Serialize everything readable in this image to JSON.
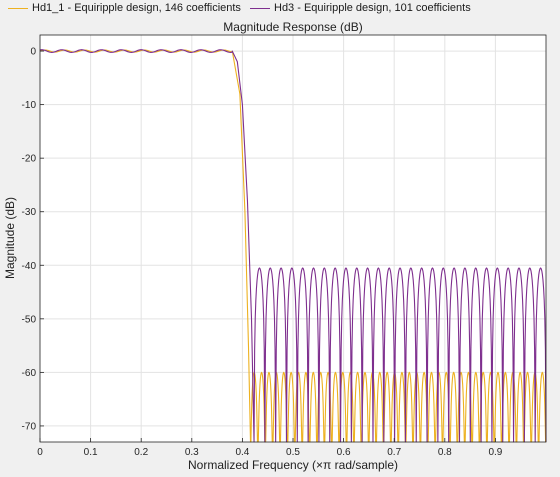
{
  "chart_data": {
    "type": "line",
    "title": "Magnitude Response (dB)",
    "xlabel": "Normalized Frequency (×π rad/sample)",
    "ylabel": "Magnitude (dB)",
    "xlim": [
      0,
      1
    ],
    "ylim": [
      -73,
      3
    ],
    "xticks": [
      0,
      0.1,
      0.2,
      0.3,
      0.4,
      0.5,
      0.6,
      0.7,
      0.8,
      0.9
    ],
    "xtick_labels": [
      "0",
      "0.1",
      "0.2",
      "0.3",
      "0.4",
      "0.5",
      "0.6",
      "0.7",
      "0.8",
      "0.9"
    ],
    "yticks": [
      0,
      -10,
      -20,
      -30,
      -40,
      -50,
      -60,
      -70
    ],
    "ytick_labels": [
      "0",
      "-10",
      "-20",
      "-30",
      "-40",
      "-50",
      "-60",
      "-70"
    ],
    "grid": true,
    "legend_position": "top",
    "series": [
      {
        "name": "Hd1_1 - Equiripple design, 146 coefficients",
        "color": "#edb120",
        "passband": {
          "start": 0,
          "edge": 0.38,
          "level_db": 0,
          "ripple_db": 0.2
        },
        "transition": [
          [
            0.38,
            0
          ],
          [
            0.395,
            -8
          ],
          [
            0.405,
            -30
          ],
          [
            0.412,
            -55
          ],
          [
            0.416,
            -73
          ]
        ],
        "stopband": {
          "start": 0.416,
          "end": 1.0,
          "peak_db": -60,
          "lobes": 40
        }
      },
      {
        "name": "Hd3 - Equiripple design, 101 coefficients",
        "color": "#7e2f8e",
        "passband": {
          "start": 0,
          "edge": 0.38,
          "level_db": 0,
          "ripple_db": 0.25
        },
        "transition": [
          [
            0.38,
            0
          ],
          [
            0.39,
            -2
          ],
          [
            0.4,
            -10
          ],
          [
            0.41,
            -28
          ],
          [
            0.418,
            -50
          ],
          [
            0.423,
            -73
          ]
        ],
        "stopband": {
          "start": 0.423,
          "end": 1.0,
          "peak_db": -40.5,
          "lobes": 27
        }
      }
    ]
  }
}
